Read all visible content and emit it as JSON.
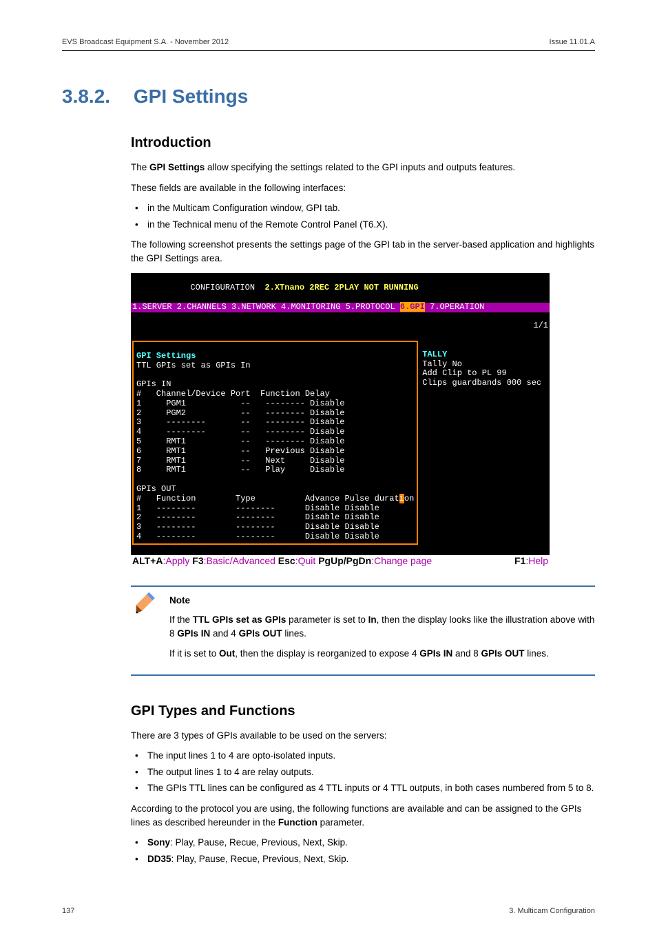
{
  "header": {
    "left": "EVS Broadcast Equipment S.A. - November 2012",
    "right": "Issue 11.01.A"
  },
  "section": {
    "number": "3.8.2.",
    "title": "GPI Settings"
  },
  "intro": {
    "heading": "Introduction",
    "p1a": "The ",
    "p1b": "GPI Settings",
    "p1c": " allow specifying the settings related to the GPI inputs and outputs features.",
    "p2": "These fields are available in the following interfaces:",
    "li1": "in the Multicam Configuration window, GPI tab.",
    "li2": "in the Technical menu of the Remote Control Panel (T6.X).",
    "p3": "The following screenshot presents the settings page of the GPI tab in the server-based application and highlights the GPI Settings area."
  },
  "screenshot": {
    "title_l": "            CONFIGURATION  ",
    "title_r": "2.XTnano 2REC 2PLAY NOT RUNNING",
    "menu": "1.SERVER 2.CHANNELS 3.NETWORK 4.MONITORING 5.PROTOCOL ",
    "menu_sel": "6.GPI",
    "menu_after": " 7.OPERATION",
    "page": "1/1",
    "body_left": "GPI Settings\nTTL GPIs set as GPIs In\n\nGPIs IN\n#   Channel/Device Port  Function Delay\n1     PGM1           --   -------- Disable\n2     PGM2           --   -------- Disable\n3     --------       --   -------- Disable\n4     --------       --   -------- Disable\n5     RMT1           --   -------- Disable\n6     RMT1           --   Previous Disable\n7     RMT1           --   Next     Disable\n8     RMT1           --   Play     Disable\n\nGPIs OUT\n#   Function        Type          Advance Pulse duration\n1   --------        --------      Disable Disable\n2   --------        --------      Disable Disable\n3   --------        --------      Disable Disable\n4   --------        --------      Disable Disable",
    "tally": {
      "l1": "TALLY",
      "l2": "Tally No",
      "l3": "Add Clip to PL 99",
      "l4": "Clips guardbands 000 sec"
    },
    "footer": {
      "k1": "ALT+A",
      "t1": ":Apply ",
      "k2": "F3",
      "t2": ":Basic/Advanced ",
      "k3": "Esc",
      "t3": ":Quit ",
      "k4": "PgUp/PgDn",
      "t4": ":Change page",
      "k5": "F1",
      "t5": ":Help"
    }
  },
  "note": {
    "title": "Note",
    "p1a": "If the ",
    "p1b": "TTL GPIs set as GPIs",
    "p1c": " parameter is set to ",
    "p1d": "In",
    "p1e": ", then the display looks like the illustration above with 8 ",
    "p1f": "GPIs IN",
    "p1g": " and 4 ",
    "p1h": "GPIs OUT",
    "p1i": " lines.",
    "p2a": "If it is set to ",
    "p2b": "Out",
    "p2c": ", then the display is reorganized to expose 4 ",
    "p2d": "GPIs IN",
    "p2e": " and 8 ",
    "p2f": "GPIs OUT",
    "p2g": " lines."
  },
  "types": {
    "heading": "GPI Types and Functions",
    "p1": "There are 3 types of GPIs available to be used on the servers:",
    "li1": "The input lines 1 to 4 are opto-isolated inputs.",
    "li2": "The output lines 1 to 4 are relay outputs.",
    "li3": "The GPIs TTL lines can be configured as 4 TTL inputs or 4 TTL outputs, in both cases numbered from 5 to 8.",
    "p2a": "According to the protocol you are using, the following functions are available and can be assigned to the GPIs lines as described hereunder in the ",
    "p2b": "Function",
    "p2c": " parameter.",
    "li4a": "Sony",
    "li4b": ": Play, Pause, Recue, Previous, Next, Skip.",
    "li5a": "DD35",
    "li5b": ": Play, Pause, Recue, Previous, Next, Skip."
  },
  "footer": {
    "left": "137",
    "right": "3. Multicam Configuration"
  }
}
